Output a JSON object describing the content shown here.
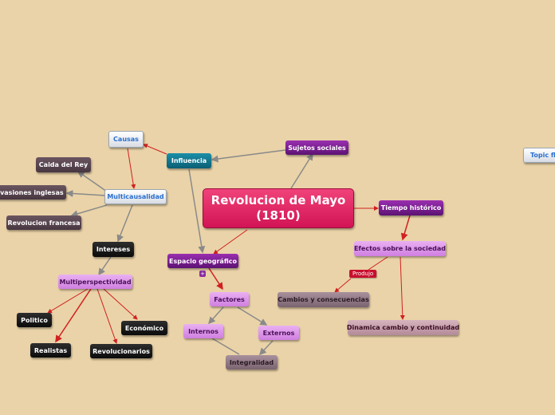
{
  "central": {
    "title": "Revolucion de Mayo (1810)"
  },
  "nodes": {
    "sujetos_sociales": "Sujetos sociales",
    "influencia": "Influencia",
    "causas": "Causas",
    "multicausalidad": "Multicausalidad",
    "caida_del_rey": "Caida del Rey",
    "invasiones_inglesas": "Invasiones inglesas",
    "revolucion_francesa": "Revolucion francesa",
    "intereses": "Intereses",
    "multiperspectividad": "Multiperspectividad",
    "politico": "Politico",
    "realistas": "Realistas",
    "revolucionarios": "Revolucionarios",
    "economico": "Económico",
    "espacio_geografico": "Espacio geográfico",
    "factores": "Factores",
    "internos": "Internos",
    "externos": "Externos",
    "integralidad": "Integralidad",
    "tiempo_historico": "Tiempo histórico",
    "efectos_sobre_la_sociedad": "Efectos sobre la sociedad",
    "cambios_y_consecuencias": "Cambios y consecuencias",
    "dinamica_cambio_y_continuidad": "Dinamica cambio y continuidad",
    "topic_floating": "Topic flo"
  },
  "link_labels": {
    "produjo": "Produjo"
  },
  "colors": {
    "background": "#ead3a8",
    "central": "#e0195f",
    "red_link": "#d02020",
    "grey_link": "#8a8a8a"
  }
}
